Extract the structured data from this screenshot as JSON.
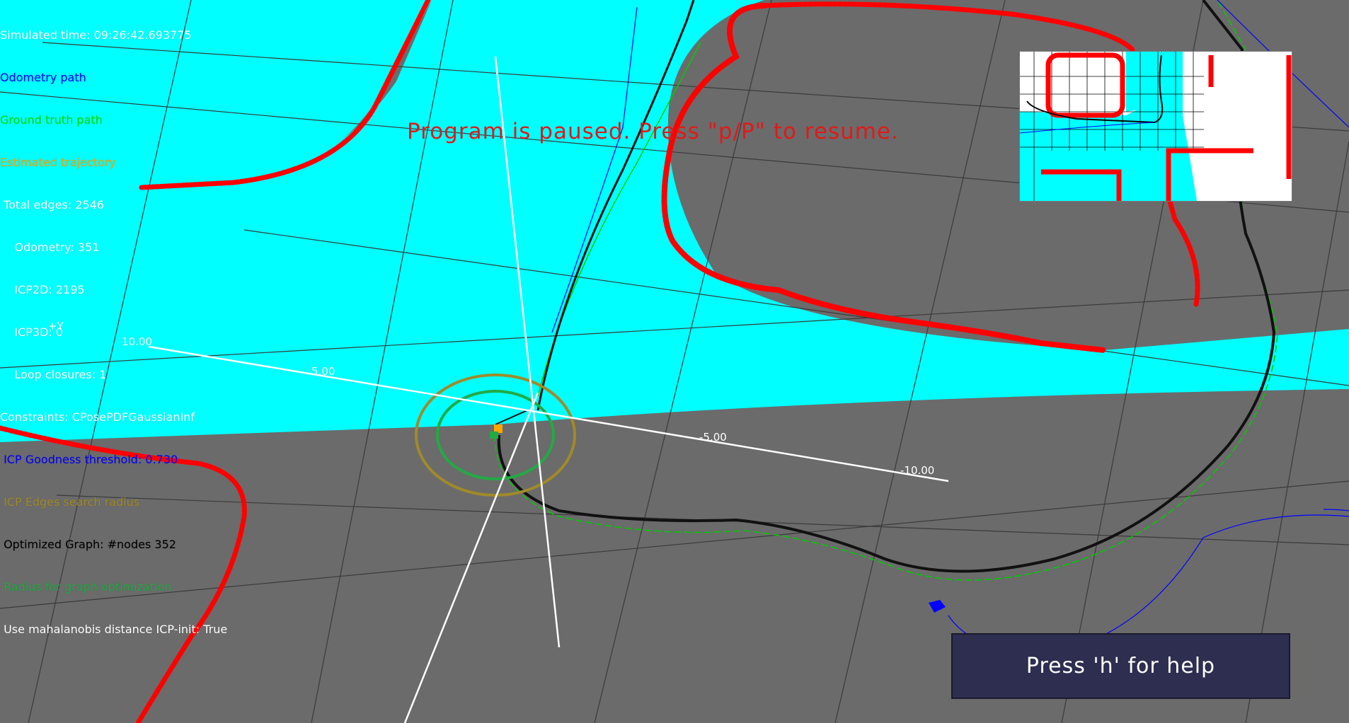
{
  "hud": {
    "simulated_time": "Simulated time: 09:26:42.693775",
    "odometry_path": "Odometry path",
    "ground_truth_path": "Ground truth path",
    "estimated_trajectory": "Estimated trajectory",
    "total_edges": " Total edges: 2546",
    "odometry": "    Odometry: 351",
    "icp2d": "    ICP2D: 2195",
    "icp3d": "    ICP3D: 0",
    "loop_closures": "    Loop closures: 1",
    "constraints": "Constraints: CPosePDFGaussianInf",
    "icp_goodness": " ICP Goodness threshold: 0.730",
    "icp_edges_radius": " ICP Edges search radius",
    "optimized_graph": " Optimized Graph: #nodes 352",
    "radius_graph_opt": " Radius for graph optimization",
    "mahalanobis": " Use mahalanobis distance ICP-init: True"
  },
  "colors": {
    "ground": "#6b6b6b",
    "free_space": "#00ffff",
    "obstacles": "#ff0000",
    "odometry": "#0000ff",
    "ground_truth": "#00cc00",
    "estimated": "#ffa500",
    "icp_radius_ring": "#a08a2a",
    "graph_radius_ring": "#22aa44",
    "hud_text": "#ffffff",
    "paused_text": "#e01a1a",
    "help_bg": "#2e2e50"
  },
  "paused_message": "Program is paused. Press \"p/P\" to resume.",
  "axes": {
    "label_y": "+Y",
    "tick_y_pos_10": "10.00",
    "tick_y_pos_5": "5.00",
    "tick_x_neg_5": "-5.00",
    "tick_x_neg_10": "-10.00"
  },
  "help": {
    "label": "Press 'h' for help"
  }
}
